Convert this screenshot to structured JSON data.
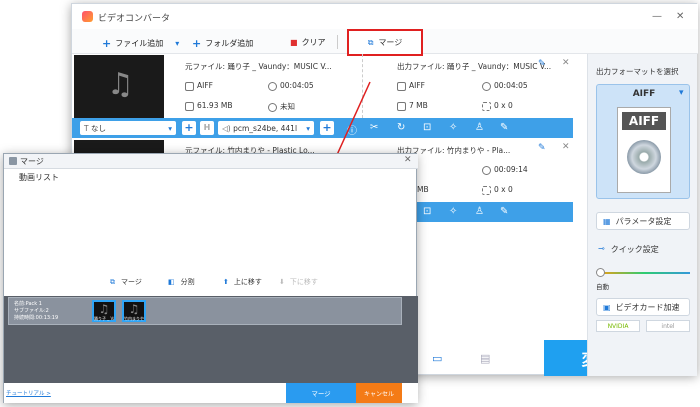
{
  "window": {
    "title": "ビデオコンバータ",
    "minimize": "—",
    "close": "✕"
  },
  "toolbar": {
    "add_file": "ファイル追加",
    "add_folder": "フォルダ追加",
    "clear": "クリア",
    "merge": "マージ"
  },
  "items": [
    {
      "source_label": "元ファイル:",
      "source_name": "踊り子 _ Vaundy：MUSIC V...",
      "format": "AIFF",
      "duration": "00:04:05",
      "size": "61.93 MB",
      "resolution": "未知",
      "output_label": "出力ファイル:",
      "output_name": "踊り子 _ Vaundy：MUSIC V...",
      "out_format": "AIFF",
      "out_duration": "00:04:05",
      "out_size": "7 MB",
      "out_resolution": "0 x 0"
    },
    {
      "source_label": "元ファイル:",
      "source_name": "竹内まりや - Plastic Lo...",
      "output_label": "出力ファイル:",
      "output_name": "竹内まりや - Pla...",
      "out_duration": "00:09:14",
      "out_size": "MB",
      "out_resolution": "0 x 0"
    }
  ],
  "edit_bar": {
    "subtitle": "なし",
    "audio": "pcm_s24be, 441l"
  },
  "right_panel": {
    "format_label": "出力フォーマットを選択",
    "format": "AIFF",
    "params": "パラメータ設定",
    "quick": "クイック設定",
    "auto": "自動",
    "gpu": "ビデオカード加速",
    "nvidia": "NVIDIA",
    "intel": "intel",
    "convert": "変換"
  },
  "dialog": {
    "title": "マージ",
    "list_label": "動画リスト",
    "actions": {
      "merge": "マージ",
      "split": "分割",
      "up": "上に移す",
      "down": "下に移す"
    },
    "pack": {
      "name": "名前:Pack 1",
      "subfiles": "サブファイル:2",
      "duration": "持続時間:00:13:19"
    },
    "clips": [
      "踊り子 _ Va...",
      "竹内まりや..."
    ],
    "tutorial": "チュートリアル >",
    "merge_btn": "マージ",
    "cancel_btn": "キャンセル"
  },
  "colors": {
    "accent": "#3ea0e8",
    "highlight": "#e02020",
    "cancel": "#f47b16",
    "dark": "#595f68"
  }
}
